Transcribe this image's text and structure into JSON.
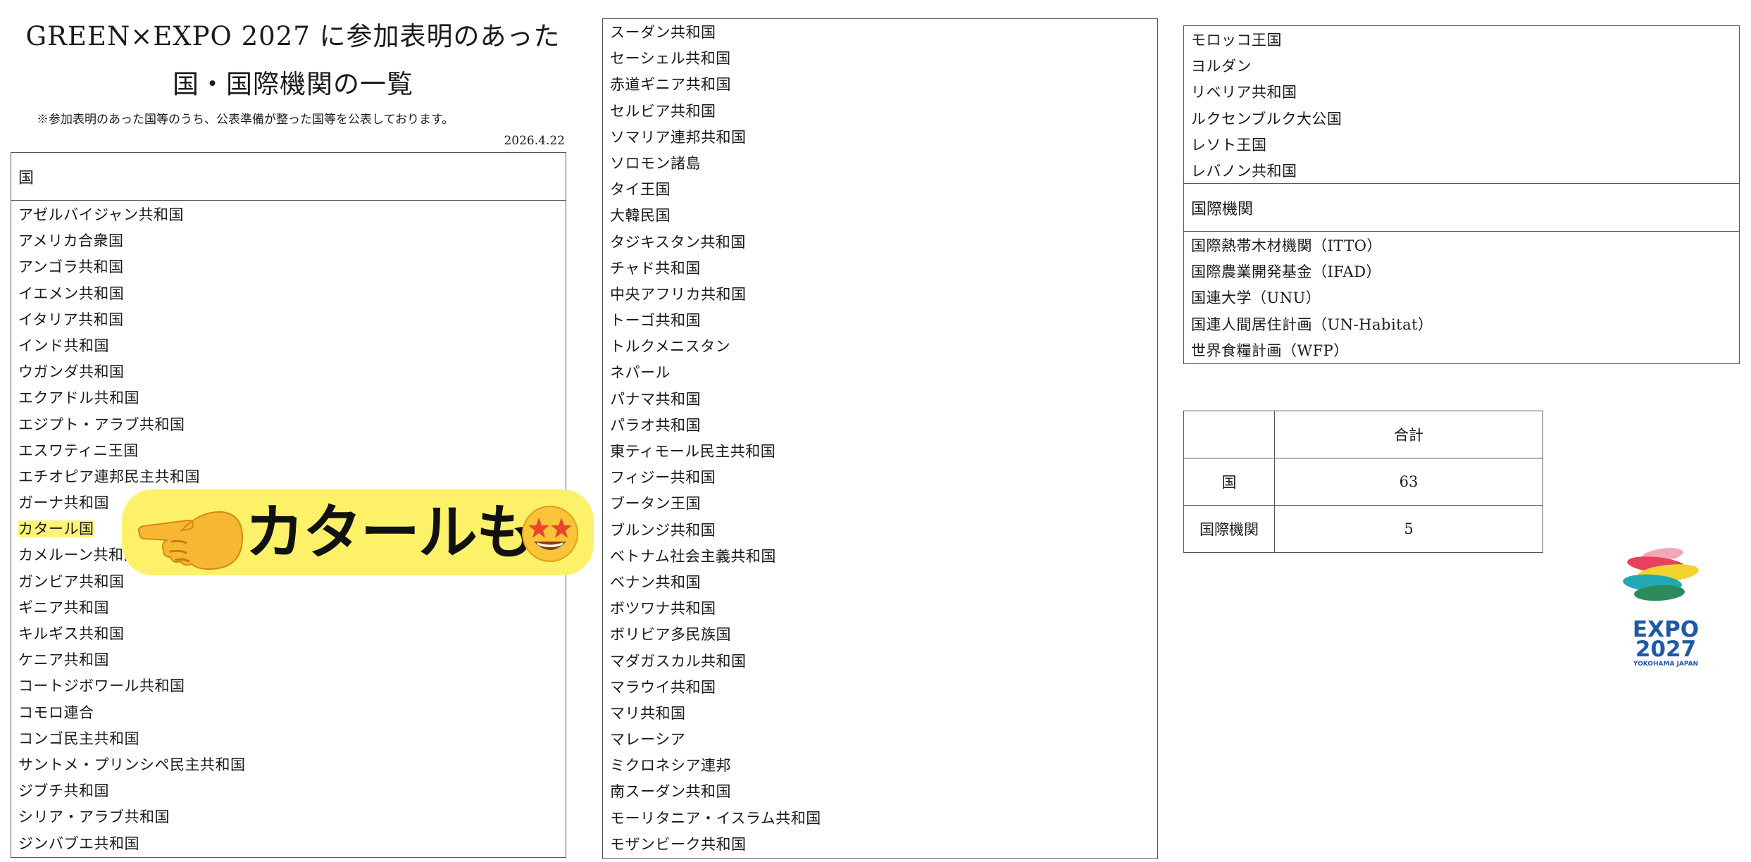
{
  "header": {
    "title_line1": "GREEN×EXPO 2027 に参加表明のあった",
    "title_line2": "国・国際機関の一覧",
    "note": "※参加表明のあった国等のうち、公表準備が整った国等を公表しております。",
    "date": "2026.4.22"
  },
  "countries_header": "国",
  "countries_col1": [
    "アゼルバイジャン共和国",
    "アメリカ合衆国",
    "アンゴラ共和国",
    "イエメン共和国",
    "イタリア共和国",
    "インド共和国",
    "ウガンダ共和国",
    "エクアドル共和国",
    "エジプト・アラブ共和国",
    "エスワティニ王国",
    "エチオピア連邦民主共和国",
    "ガーナ共和国",
    "カタール国",
    "カメルーン共和国",
    "ガンビア共和国",
    "ギニア共和国",
    "キルギス共和国",
    "ケニア共和国",
    "コートジボワール共和国",
    "コモロ連合",
    "コンゴ民主共和国",
    "サントメ・プリンシペ民主共和国",
    "ジブチ共和国",
    "シリア・アラブ共和国",
    "ジンバブエ共和国"
  ],
  "countries_col2": [
    "スーダン共和国",
    "セーシェル共和国",
    "赤道ギニア共和国",
    "セルビア共和国",
    "ソマリア連邦共和国",
    "ソロモン諸島",
    "タイ王国",
    "大韓民国",
    "タジキスタン共和国",
    "チャド共和国",
    "中央アフリカ共和国",
    "トーゴ共和国",
    "トルクメニスタン",
    "ネパール",
    "パナマ共和国",
    "パラオ共和国",
    "東ティモール民主共和国",
    "フィジー共和国",
    "ブータン王国",
    "ブルンジ共和国",
    "ベトナム社会主義共和国",
    "ベナン共和国",
    "ボツワナ共和国",
    "ボリビア多民族国",
    "マダガスカル共和国",
    "マラウイ共和国",
    "マリ共和国",
    "マレーシア",
    "ミクロネシア連邦",
    "南スーダン共和国",
    "モーリタニア・イスラム共和国",
    "モザンビーク共和国"
  ],
  "countries_col3": [
    "モロッコ王国",
    "ヨルダン",
    "リベリア共和国",
    "ルクセンブルク大公国",
    "レソト王国",
    "レバノン共和国"
  ],
  "orgs_header": "国際機関",
  "orgs": [
    "国際熱帯木材機関（ITTO）",
    "国際農業開発基金（IFAD）",
    "国連大学（UNU）",
    "国連人間居住計画（UN-Habitat）",
    "世界食糧計画（WFP）"
  ],
  "totals": {
    "header": "合計",
    "rows": [
      {
        "label": "国",
        "value": "63"
      },
      {
        "label": "国際機関",
        "value": "5"
      }
    ]
  },
  "callout": {
    "text": "カタールも",
    "hand_icon": "pointing-hand-emoji",
    "face_icon": "star-struck-emoji",
    "highlight_color": "#fdf16a"
  },
  "logo": {
    "word1": "EXPO",
    "word2": "2027",
    "word3": "YOKOHAMA JAPAN"
  }
}
